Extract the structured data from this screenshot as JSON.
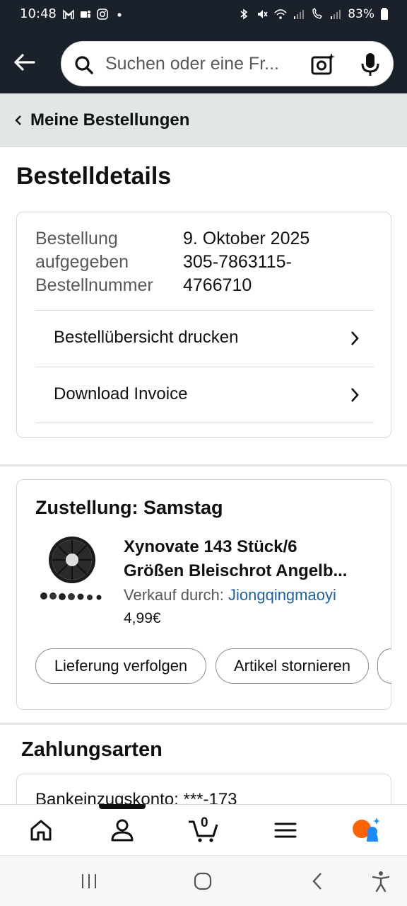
{
  "status_bar": {
    "time": "10:48",
    "battery": "83%"
  },
  "search": {
    "placeholder": "Suchen oder eine Fr..."
  },
  "breadcrumb": {
    "label": "Meine Bestellungen"
  },
  "page": {
    "title": "Bestelldetails"
  },
  "order_summary": {
    "labels": [
      "Bestellung",
      "aufgegeben",
      "Bestellnummer"
    ],
    "values": [
      "9. Oktober 2025",
      "305-7863115-",
      "4766710"
    ],
    "links": [
      {
        "label": "Bestellübersicht drucken"
      },
      {
        "label": "Download Invoice"
      }
    ]
  },
  "delivery": {
    "title": "Zustellung: Samstag",
    "product_line1": "Xynovate 143 Stück/6",
    "product_line2": "Größen Bleischrot Angelb...",
    "seller_prefix": "Verkauf durch: ",
    "seller": "Jiongqingmaoyi",
    "price": "4,99€",
    "buttons": {
      "track": "Lieferung verfolgen",
      "cancel": "Artikel stornieren"
    }
  },
  "payment": {
    "title": "Zahlungsarten",
    "method": "Bankeinzugskonto: ***-173"
  },
  "bottom_nav": {
    "cart_count": "0",
    "items": [
      "home-icon",
      "account-icon",
      "cart-icon",
      "menu-icon",
      "rufus-icon"
    ]
  },
  "colors": {
    "header_bg": "#1a212b",
    "link": "#2162a1",
    "rufus_orange": "#ff6200",
    "rufus_blue": "#1a8cff"
  }
}
